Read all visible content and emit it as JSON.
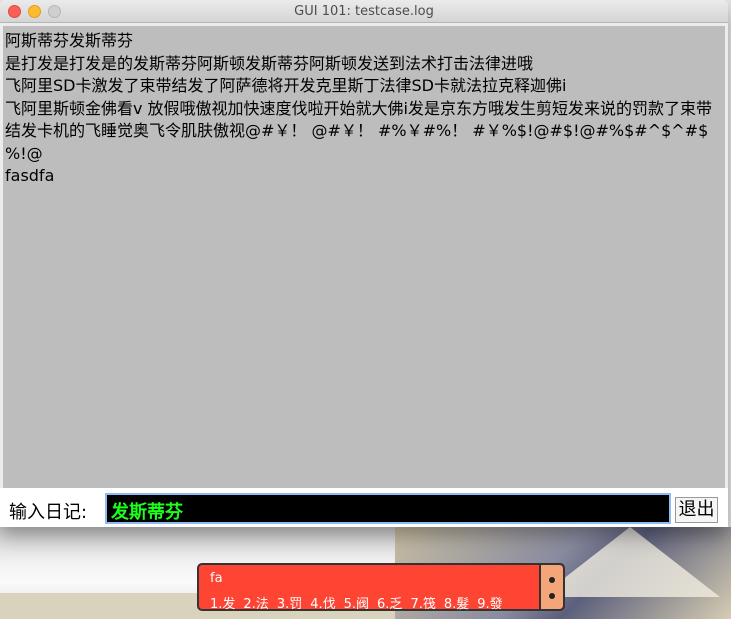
{
  "window": {
    "title": "GUI 101:  testcase.log"
  },
  "log": {
    "lines": [
      "阿斯蒂芬发斯蒂芬",
      "是打发是打发是的发斯蒂芬阿斯顿发斯蒂芬阿斯顿发送到法术打击法律进哦",
      "飞阿里SD卡激发了束带结发了阿萨德将开发克里斯丁法律SD卡就法拉克释迦佛i",
      "飞阿里斯顿金佛看v 放假哦傲视加快速度伐啦开始就大佛i发是京东方哦发生剪短发来说的罚款了束带结发卡机的飞睡觉奥飞令肌肤傲视@#￥！ @#￥！ #%￥#%！ #￥%$!@#$!@#%$#^$^#$%!@",
      "fasdfa"
    ]
  },
  "input": {
    "label": "输入日记:",
    "value": "发斯蒂芬",
    "quit_label": "退出"
  },
  "ime": {
    "composition": "fa",
    "candidates": [
      "1.发",
      "2.法",
      "3.罚",
      "4.伐",
      "5.阀",
      "6.乏",
      "7.筏",
      "8.髮",
      "9.發"
    ]
  },
  "colors": {
    "log_bg": "#bdbdbd",
    "entry_bg": "#000000",
    "entry_text": "#1bff1b",
    "ime_bg": "#fe4433"
  }
}
